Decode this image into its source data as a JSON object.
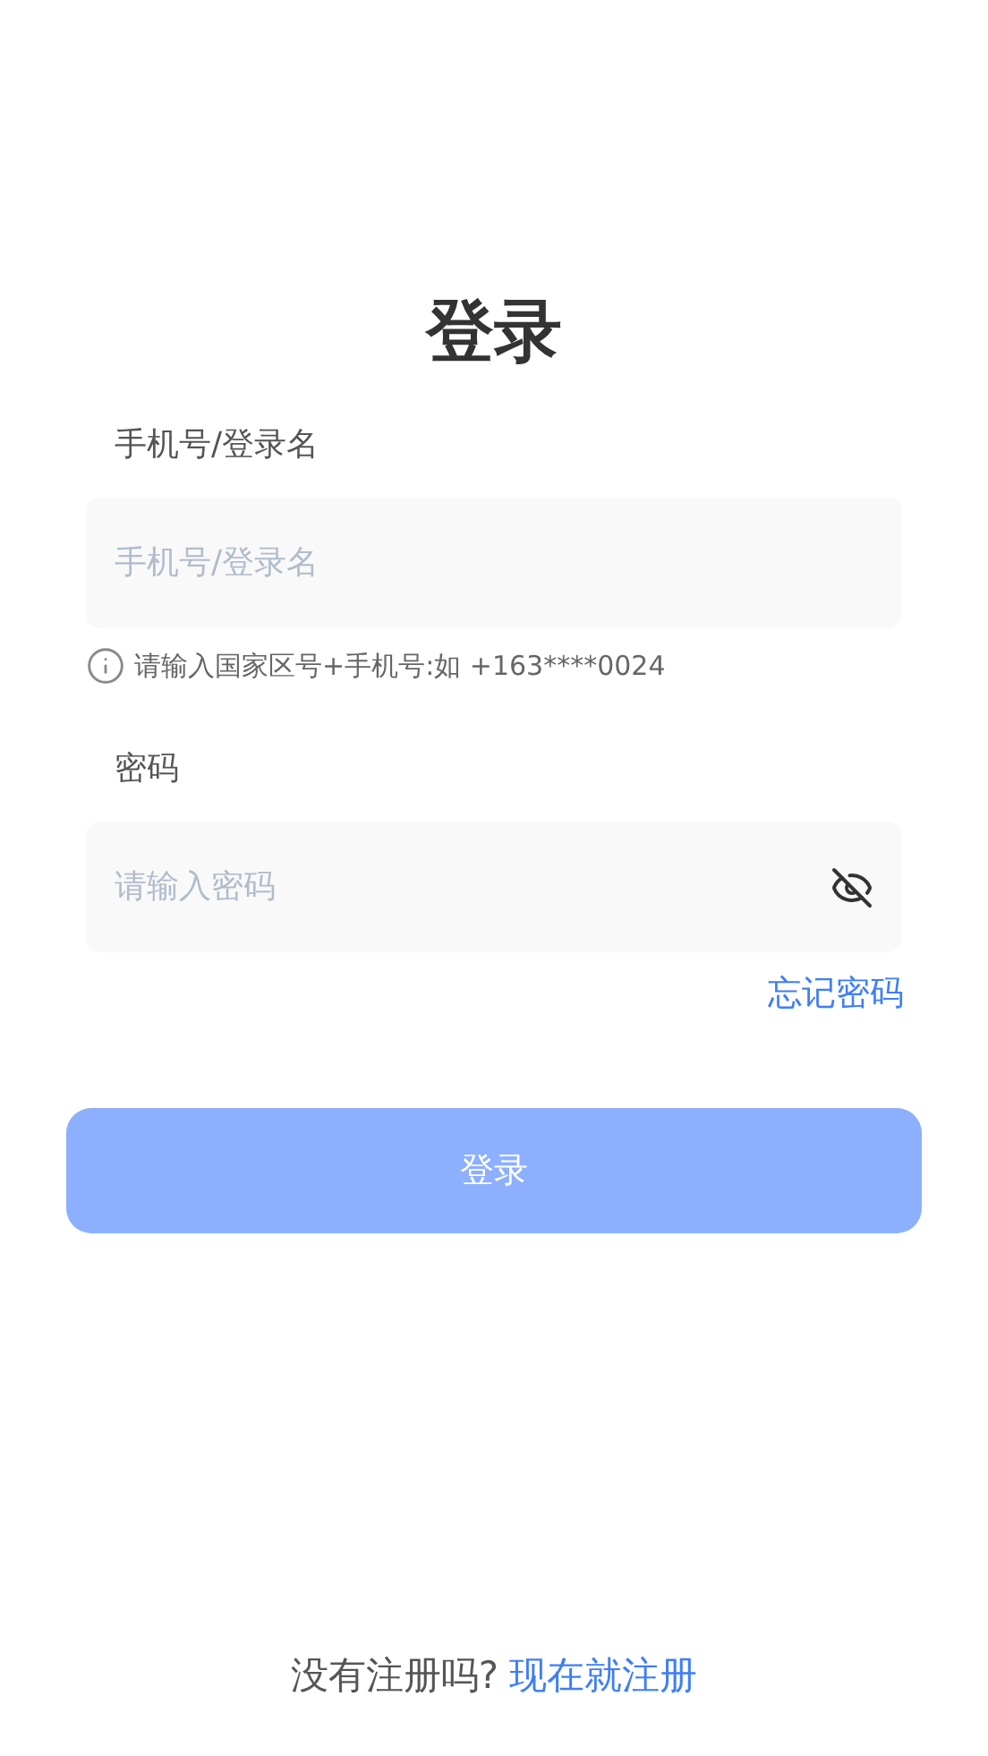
{
  "title": "登录",
  "username": {
    "label": "手机号/登录名",
    "placeholder": "手机号/登录名",
    "hint": "请输入国家区号+手机号:如 +163****0024"
  },
  "password": {
    "label": "密码",
    "placeholder": "请输入密码",
    "visible": false
  },
  "forgot_link": "忘记密码",
  "login_button": {
    "label": "登录",
    "disabled": true
  },
  "register": {
    "prompt": "没有注册吗?",
    "link": "现在就注册"
  }
}
